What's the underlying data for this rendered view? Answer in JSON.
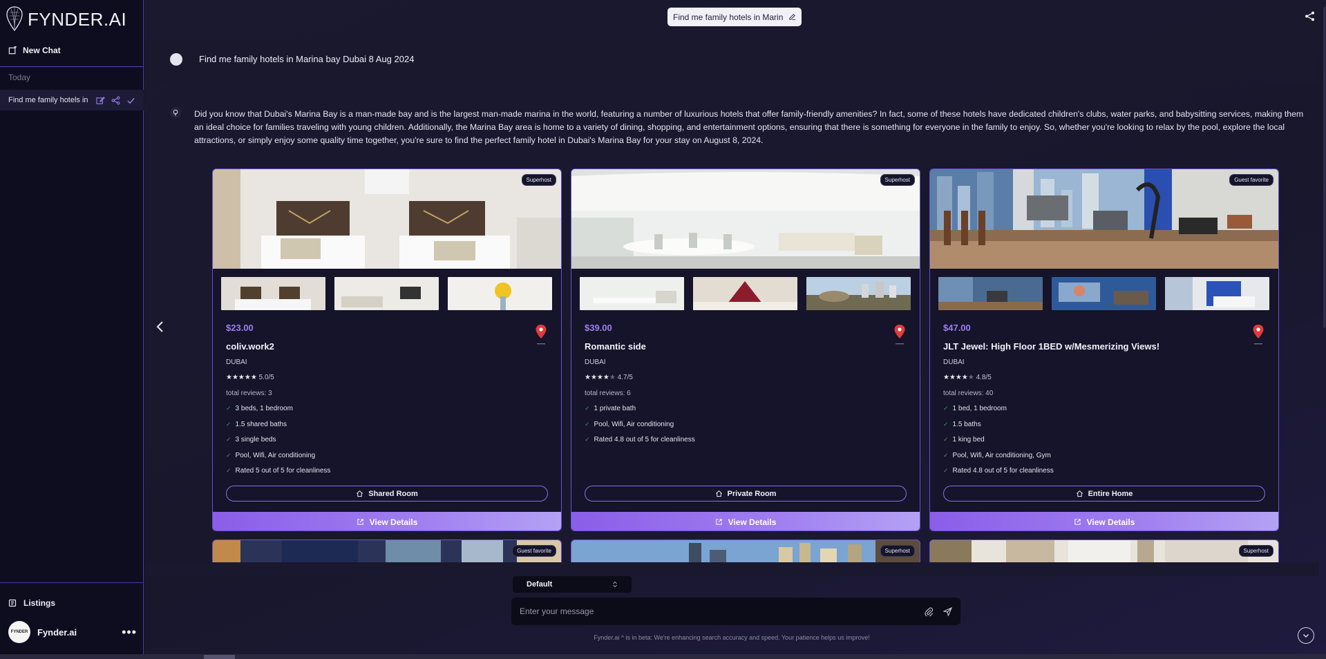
{
  "app": {
    "name": "FYNDER.AI"
  },
  "sidebar": {
    "new_chat": "New Chat",
    "section": "Today",
    "chat_item": "Find me family hotels in Marin",
    "listings": "Listings",
    "profile_name": "Fynder.ai",
    "avatar_text": "FYNDER"
  },
  "header": {
    "chat_title": "Find me family hotels in Marin"
  },
  "conversation": {
    "user_message": "Find me family hotels in Marina bay Dubai 8 Aug 2024",
    "bot_message": "Did you know that Dubai's Marina Bay is a man-made bay and is the largest man-made marina in the world, featuring a number of luxurious hotels that offer family-friendly amenities? In fact, some of these hotels have dedicated children's clubs, water parks, and babysitting services, making them an ideal choice for families traveling with young children. Additionally, the Marina Bay area is home to a variety of dining, shopping, and entertainment options, ensuring that there is something for everyone in the family to enjoy. So, whether you're looking to relax by the pool, explore the local attractions, or simply enjoy some quality time together, you're sure to find the perfect family hotel in Dubai's Marina Bay for your stay on August 8, 2024."
  },
  "listings": [
    {
      "badge": "Superhost",
      "price": "$23.00",
      "title": "coliv.work2",
      "city": "DUBAI",
      "stars": 5,
      "rating": "5.0/5",
      "reviews": "total reviews: 3",
      "features": [
        "3 beds, 1 bedroom",
        "1.5 shared baths",
        "3 single beds",
        "Pool, Wifi, Air conditioning",
        "Rated 5 out of 5 for cleanliness"
      ],
      "room_type": "Shared Room",
      "details": "View Details"
    },
    {
      "badge": "Superhost",
      "price": "$39.00",
      "title": "Romantic side",
      "city": "DUBAI",
      "stars": 4,
      "rating": "4.7/5",
      "reviews": "total reviews: 6",
      "features": [
        "1 private bath",
        "Pool, Wifi, Air conditioning",
        "Rated 4.8 out of 5 for cleanliness"
      ],
      "room_type": "Private Room",
      "details": "View Details"
    },
    {
      "badge": "Guest favorite",
      "price": "$47.00",
      "title": "JLT Jewel: High Floor 1BED w/Mesmerizing Views!",
      "city": "DUBAI",
      "stars": 4,
      "rating": "4.8/5",
      "reviews": "total reviews: 40",
      "features": [
        "1 bed, 1 bedroom",
        "1.5 baths",
        "1 king bed",
        "Pool, Wifi, Air conditioning, Gym",
        "Rated 4.8 out of 5 for cleanliness"
      ],
      "room_type": "Entire Home",
      "details": "View Details"
    }
  ],
  "next_row_badges": [
    "Guest favorite",
    "Superhost",
    "Superhost"
  ],
  "composer": {
    "mode": "Default",
    "placeholder": "Enter your message",
    "footer": "Fynder.ai ^ is in beta: We're enhancing search accuracy and speed. Your patience helps us improve!"
  }
}
